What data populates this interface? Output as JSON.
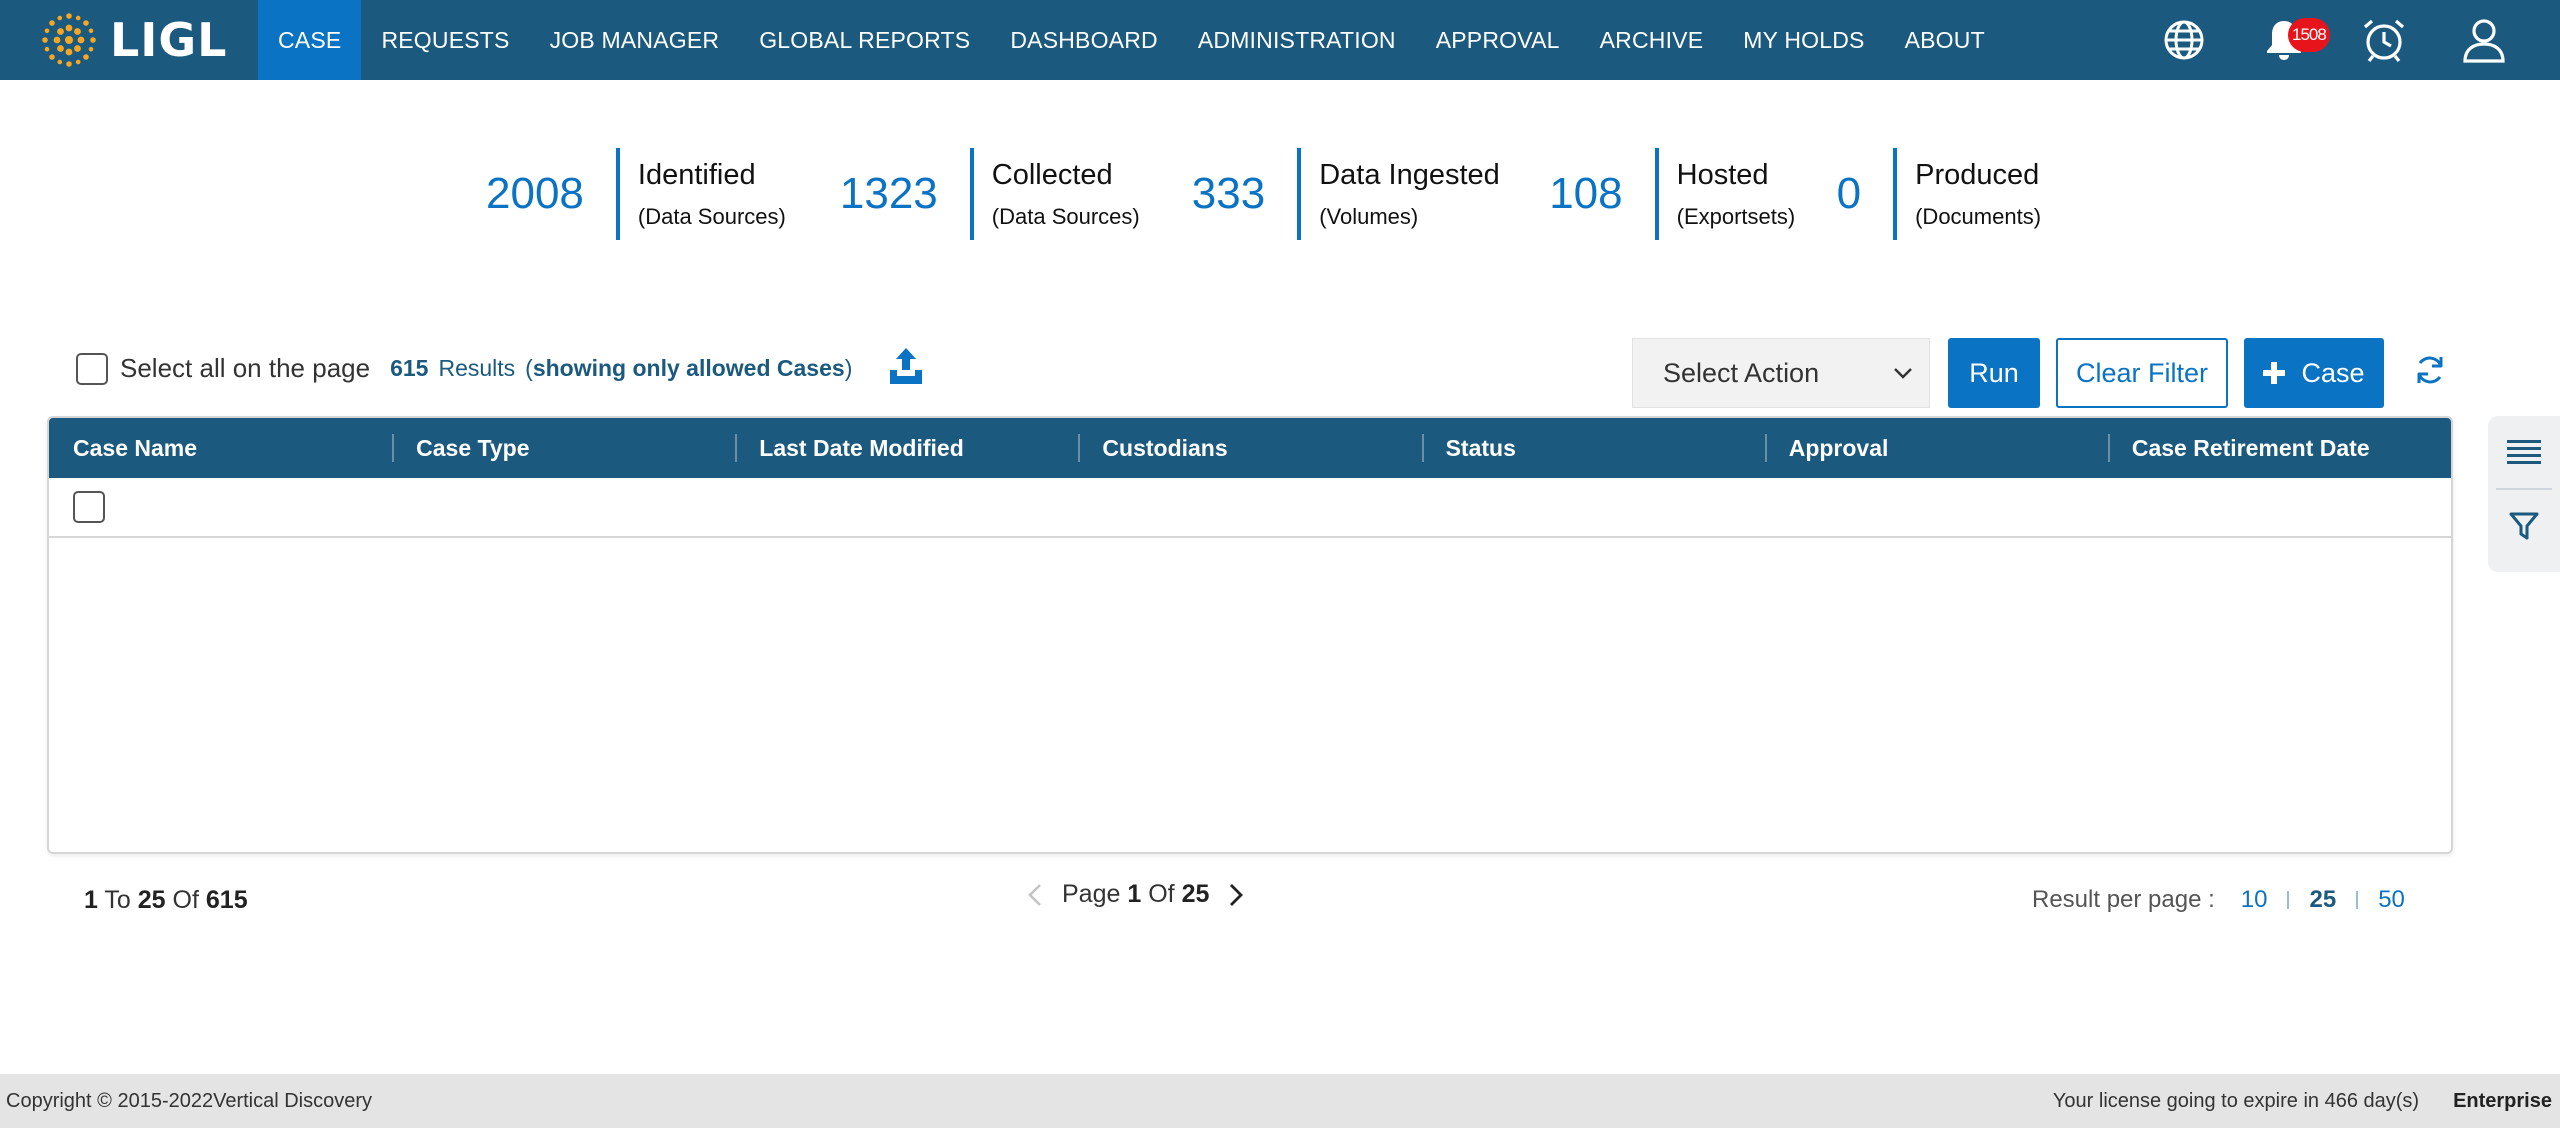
{
  "brand": {
    "name": "LIGL",
    "color": "#1b5a7e",
    "accent": "#0b73c4"
  },
  "nav": {
    "items": [
      {
        "label": "CASE",
        "active": true
      },
      {
        "label": "REQUESTS"
      },
      {
        "label": "JOB MANAGER"
      },
      {
        "label": "GLOBAL REPORTS"
      },
      {
        "label": "DASHBOARD"
      },
      {
        "label": "ADMINISTRATION"
      },
      {
        "label": "APPROVAL"
      },
      {
        "label": "ARCHIVE"
      },
      {
        "label": "MY HOLDS"
      },
      {
        "label": "ABOUT"
      }
    ],
    "icons": [
      "globe-icon",
      "bell-icon",
      "alarm-clock-icon",
      "user-icon"
    ],
    "notification_count": "1508"
  },
  "stats": [
    {
      "value": "2008",
      "label": "Identified",
      "sub": "(Data Sources)"
    },
    {
      "value": "1323",
      "label": "Collected",
      "sub": "(Data Sources)"
    },
    {
      "value": "333",
      "label": "Data Ingested",
      "sub": "(Volumes)"
    },
    {
      "value": "108",
      "label": "Hosted",
      "sub": "(Exportsets)"
    },
    {
      "value": "0",
      "label": "Produced",
      "sub": "(Documents)"
    }
  ],
  "toolbar": {
    "select_all_label": "Select all on the page",
    "result_count": "615",
    "results_word": "Results",
    "note_open": "(",
    "note_bold": "showing only allowed Cases",
    "note_close": ")",
    "select_action": "Select Action",
    "run": "Run",
    "clear_filter": "Clear Filter",
    "add_case": "Case"
  },
  "table": {
    "columns": [
      "Case Name",
      "Case Type",
      "Last Date Modified",
      "Custodians",
      "Status",
      "Approval",
      "Case Retirement Date"
    ],
    "rows": []
  },
  "pagination": {
    "from": "1",
    "to_word": "To",
    "to": "25",
    "of_word": "Of",
    "total": "615",
    "page_word": "Page",
    "page": "1",
    "pages": "25",
    "per_page_label": "Result per page :",
    "per_page_options": [
      "10",
      "25",
      "50"
    ],
    "per_page_selected": "25"
  },
  "footer": {
    "copyright": "Copyright © 2015-2022Vertical Discovery",
    "license": "Your license going to expire in 466 day(s)",
    "edition": "Enterprise"
  }
}
